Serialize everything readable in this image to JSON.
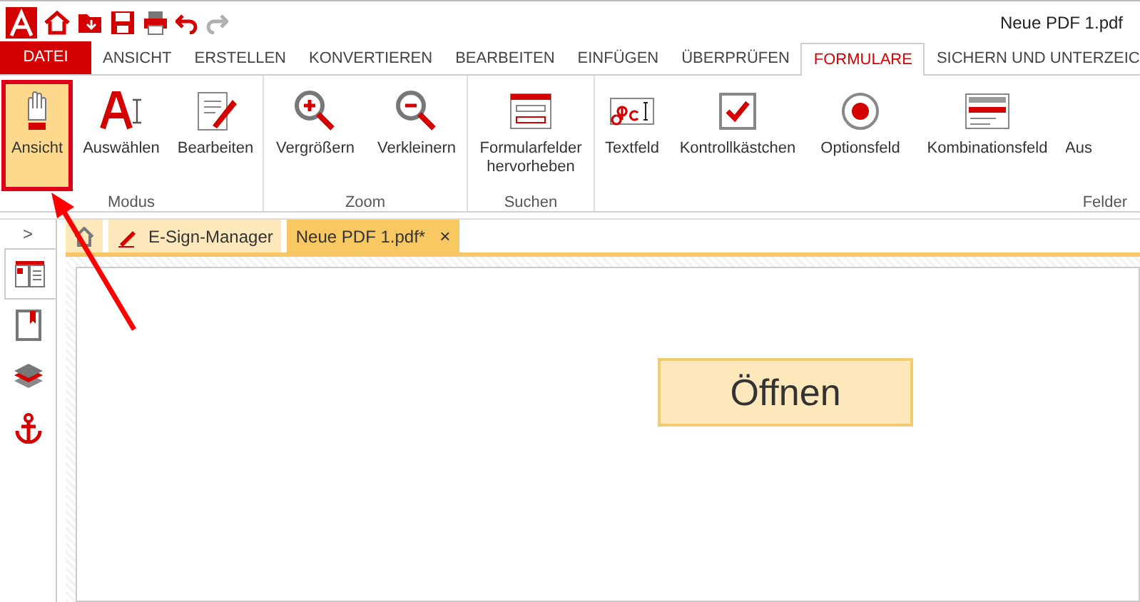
{
  "window": {
    "title": "Neue PDF 1.pdf"
  },
  "quick_access": [
    {
      "kind": "logo"
    },
    {
      "kind": "home"
    },
    {
      "kind": "folder"
    },
    {
      "kind": "save"
    },
    {
      "kind": "print"
    },
    {
      "kind": "undo",
      "disabled": false
    },
    {
      "kind": "redo",
      "disabled": true
    }
  ],
  "file_tab": {
    "label": "DATEI"
  },
  "tabs": [
    {
      "label": "ANSICHT",
      "selected": false
    },
    {
      "label": "ERSTELLEN",
      "selected": false
    },
    {
      "label": "KONVERTIEREN",
      "selected": false
    },
    {
      "label": "BEARBEITEN",
      "selected": false
    },
    {
      "label": "EINFÜGEN",
      "selected": false
    },
    {
      "label": "ÜBERPRÜFEN",
      "selected": false
    },
    {
      "label": "FORMULARE",
      "selected": true
    },
    {
      "label": "SICHERN UND UNTERZEIC",
      "selected": false
    }
  ],
  "ribbon_groups": [
    {
      "label": "Modus",
      "items": [
        {
          "kind": "hand",
          "label": "Ansicht",
          "selected": true,
          "highlighted": true
        },
        {
          "kind": "select",
          "label": "Auswählen",
          "selected": false,
          "highlighted": false
        },
        {
          "kind": "edit",
          "label": "Bearbeiten",
          "selected": false,
          "highlighted": false
        }
      ]
    },
    {
      "label": "Zoom",
      "items": [
        {
          "kind": "zoomin",
          "label": "Vergrößern",
          "selected": false,
          "highlighted": false
        },
        {
          "kind": "zoomout",
          "label": "Verkleinern",
          "selected": false,
          "highlighted": false
        }
      ]
    },
    {
      "label": "Suchen",
      "items": [
        {
          "kind": "formfields",
          "label": "Formularfelder hervorheben",
          "selected": false,
          "highlighted": false
        }
      ]
    },
    {
      "label": "Felder",
      "items": [
        {
          "kind": "textfield",
          "label": "Textfeld",
          "selected": false,
          "highlighted": false
        },
        {
          "kind": "checkbox",
          "label": "Kontrollkästchen",
          "selected": false,
          "highlighted": false
        },
        {
          "kind": "radio",
          "label": "Optionsfeld",
          "selected": false,
          "highlighted": false
        },
        {
          "kind": "combo",
          "label": "Kombinationsfeld",
          "selected": false,
          "highlighted": false
        },
        {
          "kind": "partial",
          "label": "Aus",
          "selected": false,
          "highlighted": false
        }
      ]
    }
  ],
  "sidebar": {
    "expand_label": ">",
    "items": [
      {
        "kind": "pages",
        "selected": true
      },
      {
        "kind": "bookmarks",
        "selected": false
      },
      {
        "kind": "layers",
        "selected": false
      },
      {
        "kind": "anchor",
        "selected": false
      }
    ]
  },
  "doc_tabs": [
    {
      "kind": "home",
      "selected": false
    },
    {
      "kind": "esign",
      "label": "E-Sign-Manager",
      "selected": false
    },
    {
      "kind": "doc",
      "label": "Neue PDF 1.pdf*",
      "selected": true,
      "close": "×"
    }
  ],
  "document": {
    "button": {
      "label": "Öffnen"
    }
  }
}
